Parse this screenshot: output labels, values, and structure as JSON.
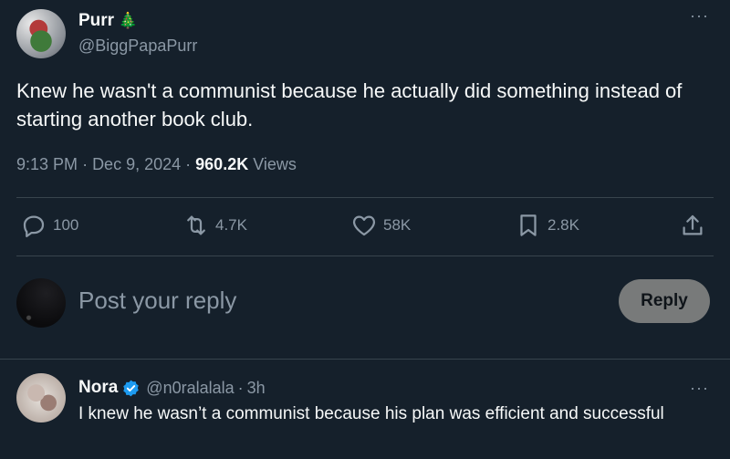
{
  "tweet": {
    "display_name": "Purr",
    "name_emoji": "🎄",
    "handle": "@BiggPapaPurr",
    "text": "Knew he wasn't a communist because he actually did something instead of starting another book club.",
    "time": "9:13 PM",
    "date": "Dec 9, 2024",
    "views_count": "960.2K",
    "views_label": "Views",
    "more": "···"
  },
  "actions": {
    "replies": "100",
    "reposts": "4.7K",
    "likes": "58K",
    "bookmarks": "2.8K"
  },
  "composer": {
    "placeholder": "Post your reply",
    "button_label": "Reply"
  },
  "reply": {
    "display_name": "Nora",
    "handle": "@n0ralalala",
    "time": "3h",
    "text": "I knew he wasn’t a communist because his plan was efficient and successful",
    "more": "···"
  },
  "colors": {
    "background": "#15202b",
    "secondary_text": "#8b98a5",
    "verified": "#1d9bf0",
    "reply_button": "#787a7a"
  }
}
